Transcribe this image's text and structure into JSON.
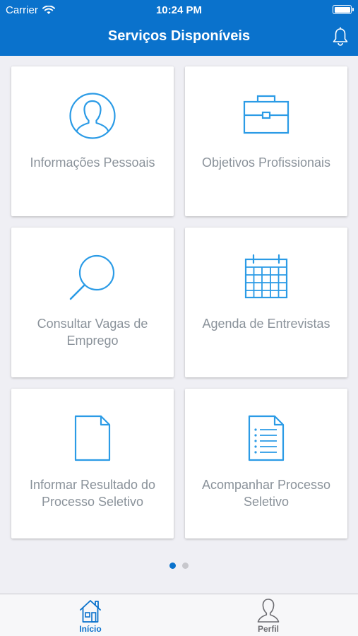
{
  "status_bar": {
    "carrier": "Carrier",
    "time": "10:24 PM"
  },
  "header": {
    "title": "Serviços Disponíveis",
    "notification_icon": "bell-icon"
  },
  "colors": {
    "primary": "#0a72cc",
    "icon_blue": "#2b9be6",
    "label_gray": "#8a929a"
  },
  "services": [
    {
      "label": "Informações Pessoais",
      "icon": "person-icon"
    },
    {
      "label": "Objetivos Profissionais",
      "icon": "briefcase-icon"
    },
    {
      "label": "Consultar Vagas de Emprego",
      "icon": "magnifier-icon"
    },
    {
      "label": "Agenda de Entrevistas",
      "icon": "calendar-icon"
    },
    {
      "label": "Informar Resultado do Processo Seletivo",
      "icon": "document-icon"
    },
    {
      "label": "Acompanhar Processo Seletivo",
      "icon": "list-document-icon"
    }
  ],
  "pagination": {
    "pages": 2,
    "current": 1
  },
  "tabs": [
    {
      "label": "Início",
      "icon": "home-icon",
      "active": true
    },
    {
      "label": "Perfil",
      "icon": "profile-icon",
      "active": false
    }
  ]
}
